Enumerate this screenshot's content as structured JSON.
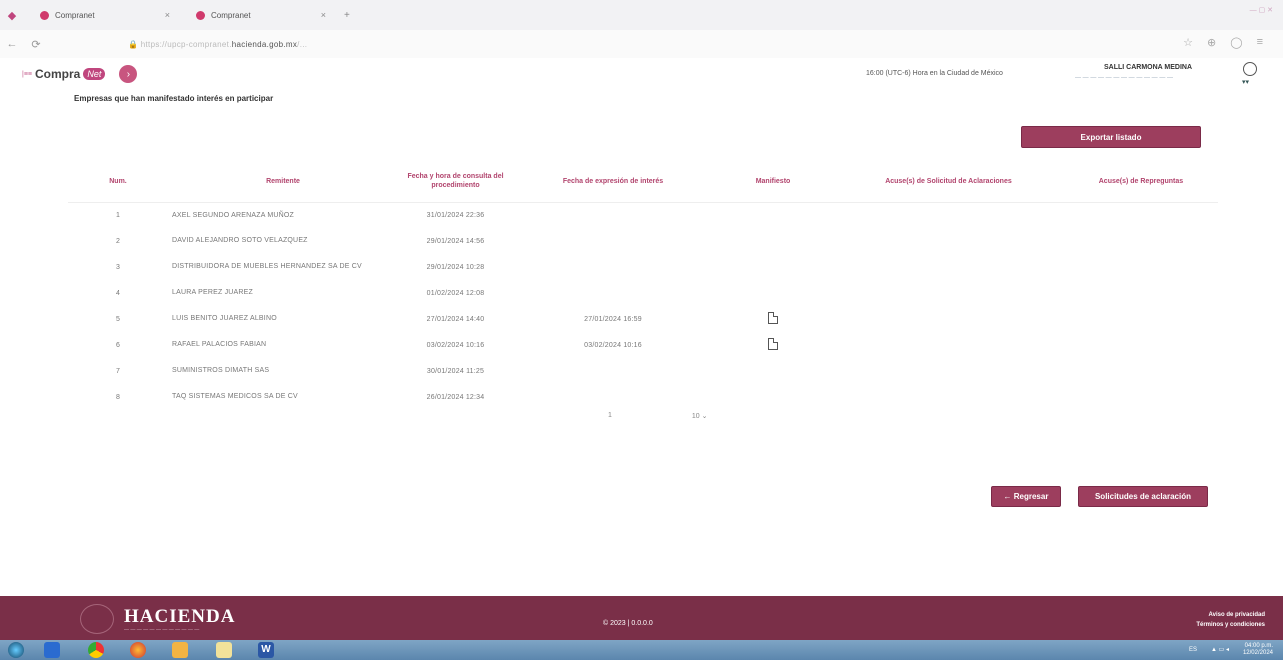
{
  "browser": {
    "tabs": [
      {
        "label": "Compranet"
      },
      {
        "label": "Compranet"
      }
    ],
    "url_domain": "hacienda.gob.mx"
  },
  "header": {
    "logo_text": "Compra",
    "logo_badge": "Net",
    "toggle_symbol": "›",
    "time_info": "16:00 (UTC-6) Hora en la Ciudad de México",
    "user_name": "SALLI CARMONA MEDINA"
  },
  "main": {
    "section_title": "Empresas que han manifestado interés en participar",
    "export_button": "Exportar listado",
    "table": {
      "headers": {
        "num": "Num.",
        "remitente": "Remitente",
        "fecha_consulta": "Fecha y hora de consulta del procedimiento",
        "fecha_interes": "Fecha de expresión de interés",
        "manifiesto": "Manifiesto",
        "acuse_aclaraciones": "Acuse(s) de Solicitud de Aclaraciones",
        "acuse_repreguntas": "Acuse(s) de Repreguntas"
      },
      "rows": [
        {
          "num": "1",
          "remitente": "AXEL SEGUNDO ARENAZA MUÑOZ",
          "fecha_consulta": "31/01/2024 22:36",
          "fecha_interes": "",
          "manifiesto": false
        },
        {
          "num": "2",
          "remitente": "DAVID ALEJANDRO SOTO VELAZQUEZ",
          "fecha_consulta": "29/01/2024 14:56",
          "fecha_interes": "",
          "manifiesto": false
        },
        {
          "num": "3",
          "remitente": "DISTRIBUIDORA DE MUEBLES HERNANDEZ SA DE CV",
          "fecha_consulta": "29/01/2024 10:28",
          "fecha_interes": "",
          "manifiesto": false
        },
        {
          "num": "4",
          "remitente": "LAURA PEREZ JUAREZ",
          "fecha_consulta": "01/02/2024 12:08",
          "fecha_interes": "",
          "manifiesto": false
        },
        {
          "num": "5",
          "remitente": "LUIS BENITO JUAREZ ALBINO",
          "fecha_consulta": "27/01/2024 14:40",
          "fecha_interes": "27/01/2024 16:59",
          "manifiesto": true
        },
        {
          "num": "6",
          "remitente": "RAFAEL PALACIOS FABIAN",
          "fecha_consulta": "03/02/2024 10:16",
          "fecha_interes": "03/02/2024 10:16",
          "manifiesto": true
        },
        {
          "num": "7",
          "remitente": "SUMINISTROS DIMATH SAS",
          "fecha_consulta": "30/01/2024 11:25",
          "fecha_interes": "",
          "manifiesto": false
        },
        {
          "num": "8",
          "remitente": "TAQ SISTEMAS MEDICOS SA DE CV",
          "fecha_consulta": "26/01/2024 12:34",
          "fecha_interes": "",
          "manifiesto": false
        }
      ]
    },
    "pager": {
      "page": "1",
      "per_page": "10 ⌄"
    },
    "back_button": "← Regresar",
    "clarifications_button": "Solicitudes de aclaración"
  },
  "footer": {
    "brand": "HACIENDA",
    "copyright": "© 2023 | 0.0.0.0",
    "privacy": "Aviso de privacidad",
    "terms": "Términos y condiciones"
  },
  "taskbar": {
    "lang": "ES",
    "time": "04:00 p.m.",
    "date": "12/02/2024"
  },
  "colors": {
    "accent": "#9d3e5e",
    "header_text": "#b2456e",
    "footer_bg": "#7a2f48"
  }
}
